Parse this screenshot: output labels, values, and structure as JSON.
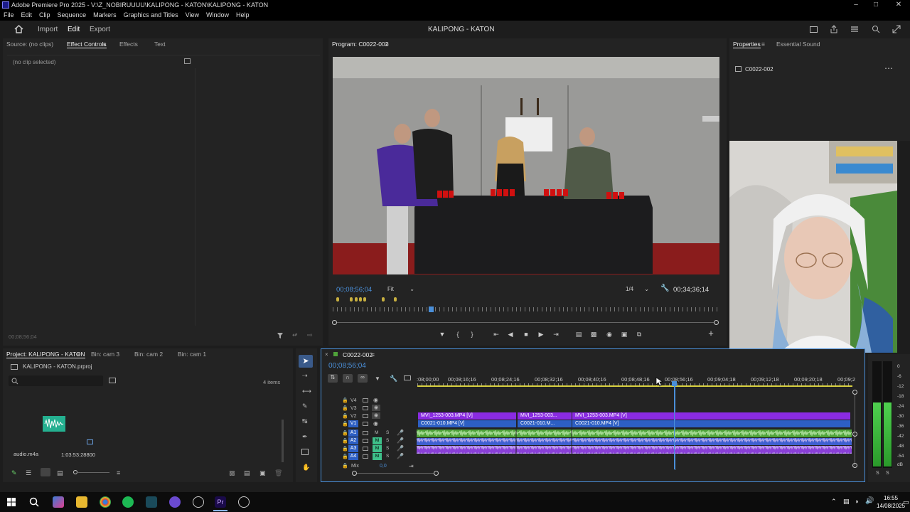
{
  "window": {
    "title": "Adobe Premiere Pro 2025 - V:\\Z_NOBIRUUUU\\KALIPONG - KATON\\KALIPONG - KATON"
  },
  "menu": [
    "File",
    "Edit",
    "Clip",
    "Sequence",
    "Markers",
    "Graphics and Titles",
    "View",
    "Window",
    "Help"
  ],
  "workspace": {
    "import": "Import",
    "edit": "Edit",
    "export": "Export",
    "project_title": "KALIPONG - KATON"
  },
  "source_panel": {
    "tabs": [
      "Source: (no clips)",
      "Effect Controls",
      "Effects",
      "Text"
    ],
    "empty_label": "(no clip selected)",
    "timecode": "00;08;56;04"
  },
  "program": {
    "tab": "Program: C0022-002",
    "timecode": "00;08;56;04",
    "fit": "Fit",
    "quality": "1/4",
    "duration": "00;34;36;14"
  },
  "properties": {
    "tabs": [
      "Properties",
      "Essential Sound"
    ],
    "clip_name": "C0022-002"
  },
  "project_panel": {
    "tabs": [
      "Project: KALIPONG - KATON",
      "Bin: cam 3",
      "Bin: cam 2",
      "Bin: cam 1"
    ],
    "file": "KALIPONG - KATON.prproj",
    "item_count": "4 items",
    "item_name": "audio.m4a",
    "item_duration": "1:03:53:28800"
  },
  "timeline": {
    "tab": "C0022-002",
    "timecode": "00;08;56;04",
    "ruler": [
      ":08;00;00",
      "00;08;16;16",
      "00;08;24;16",
      "00;08;32;16",
      "00;08;40;16",
      "00;08;48;16",
      "00;08;56;16",
      "00;09;04;18",
      "00;09;12;18",
      "00;09;20;18",
      "00;09;2"
    ],
    "video_tracks": [
      "V4",
      "V3",
      "V2",
      "V1"
    ],
    "audio_tracks": [
      "A1",
      "A2",
      "A3",
      "A4"
    ],
    "mix_label": "Mix",
    "mix_value": "0,0",
    "v2_clips": [
      "MVI_1253-003.MP4 [V]",
      "MVI_1253-003...",
      "MVI_1253-003.MP4 [V]"
    ],
    "v1_clips": [
      "C0021-010.MP4 [V]",
      "C0021-010.M...",
      "C0021-010.MP4 [V]"
    ]
  },
  "meter": {
    "scale": [
      "0",
      "-6",
      "-12",
      "-18",
      "-24",
      "-30",
      "-36",
      "-42",
      "-48",
      "-54",
      "dB"
    ],
    "solo": [
      "S",
      "S"
    ]
  },
  "taskbar": {
    "time": "16:55",
    "date": "14/08/2025"
  },
  "colors": {
    "accent": "#4a8fd9",
    "clip_video_purple": "#8a2be2",
    "clip_v1_blue": "#2d5fc4",
    "audio_green": "#4fa23a"
  }
}
